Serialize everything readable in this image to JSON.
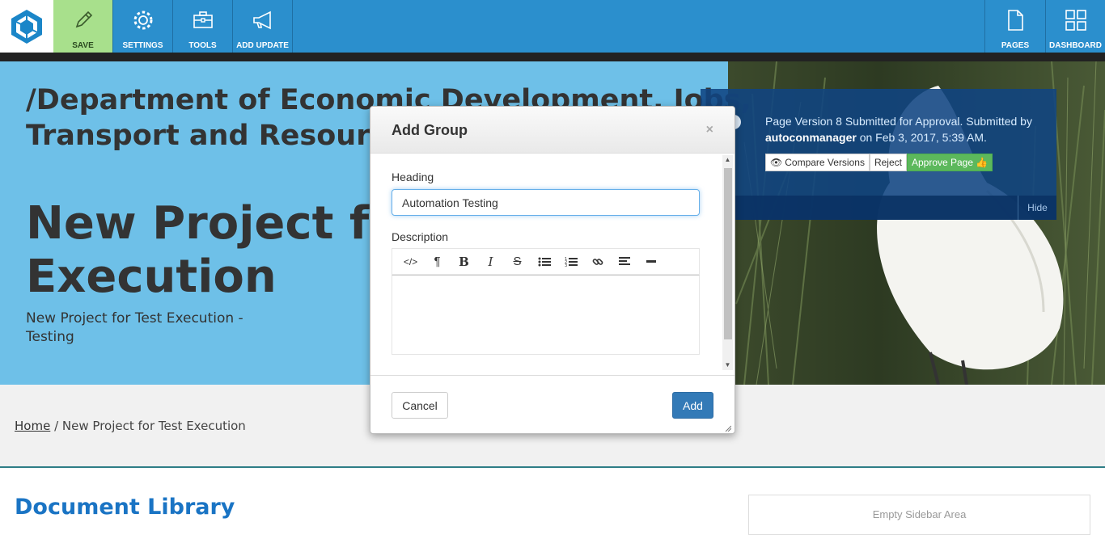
{
  "toolbar": {
    "save_label": "SAVE",
    "settings_label": "SETTINGS",
    "tools_label": "TOOLS",
    "add_update_label": "ADD UPDATE",
    "pages_label": "PAGES",
    "dashboard_label": "DASHBOARD",
    "accent_color": "#2b8fcd",
    "save_color": "#a8e08c"
  },
  "hero": {
    "title": "/Department of Economic Development, Jobs, Transport and Resources",
    "heading": "New Project for Test Execution",
    "subtitle": "New Project for Test Execution - Testing"
  },
  "notice": {
    "message_prefix": "Page Version 8 Submitted for Approval. Submitted by",
    "user": "autoconmanager",
    "message_suffix": "on Feb 3, 2017, 5:39 AM.",
    "compare_label": "Compare Versions",
    "reject_label": "Reject",
    "approve_label": "Approve Page",
    "hide_label": "Hide"
  },
  "breadcrumb": {
    "home": "Home",
    "separator": "/",
    "current": "New Project for Test Execution"
  },
  "main": {
    "document_library": "Document Library",
    "sidebar_empty": "Empty Sidebar Area"
  },
  "modal": {
    "title": "Add Group",
    "close": "×",
    "heading_label": "Heading",
    "heading_value": "Automation Testing",
    "description_label": "Description",
    "editor_buttons": [
      "code-icon",
      "paragraph-icon",
      "bold-icon",
      "italic-icon",
      "strikethrough-icon",
      "bullet-list-icon",
      "numbered-list-icon",
      "link-icon",
      "align-icon",
      "horizontal-rule-icon"
    ],
    "cancel_label": "Cancel",
    "add_label": "Add"
  }
}
